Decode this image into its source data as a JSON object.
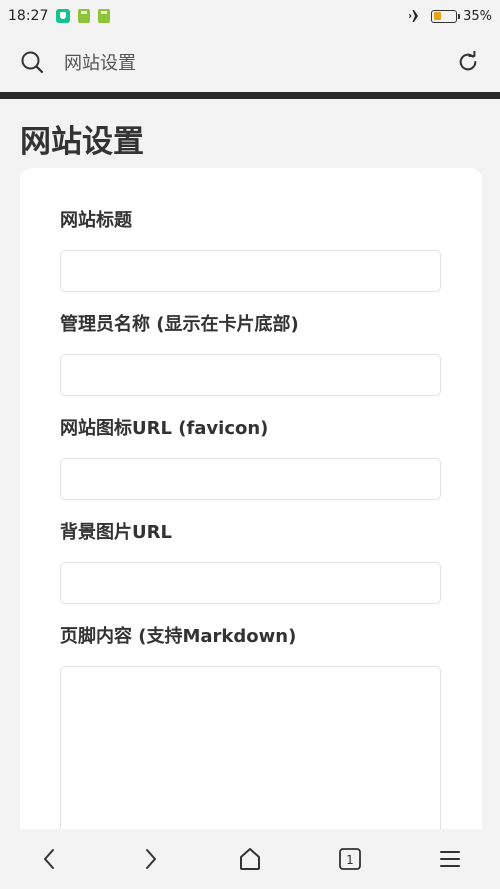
{
  "status_bar": {
    "time": "18:27",
    "battery_percent_text": "35%",
    "battery_level": 0.35,
    "icons": [
      "app-notification-icon",
      "notification-icon",
      "notification-icon",
      "airplane-mode-icon",
      "battery-icon"
    ]
  },
  "browser": {
    "address_text": "网站设置",
    "tab_count": "1"
  },
  "page": {
    "title": "网站设置"
  },
  "form": {
    "fields": [
      {
        "label": "网站标题",
        "value": ""
      },
      {
        "label": "管理员名称 (显示在卡片底部)",
        "value": ""
      },
      {
        "label": "网站图标URL (favicon)",
        "value": ""
      },
      {
        "label": "背景图片URL",
        "value": ""
      },
      {
        "label": "页脚内容 (支持Markdown)",
        "value": ""
      }
    ]
  },
  "colors": {
    "background": "#f3f3f3",
    "card": "#ffffff",
    "divider_bar": "#2a2a2a",
    "battery": "#e8a21a",
    "notification_teal": "#14c38e",
    "notification_green": "#8fc33a"
  }
}
